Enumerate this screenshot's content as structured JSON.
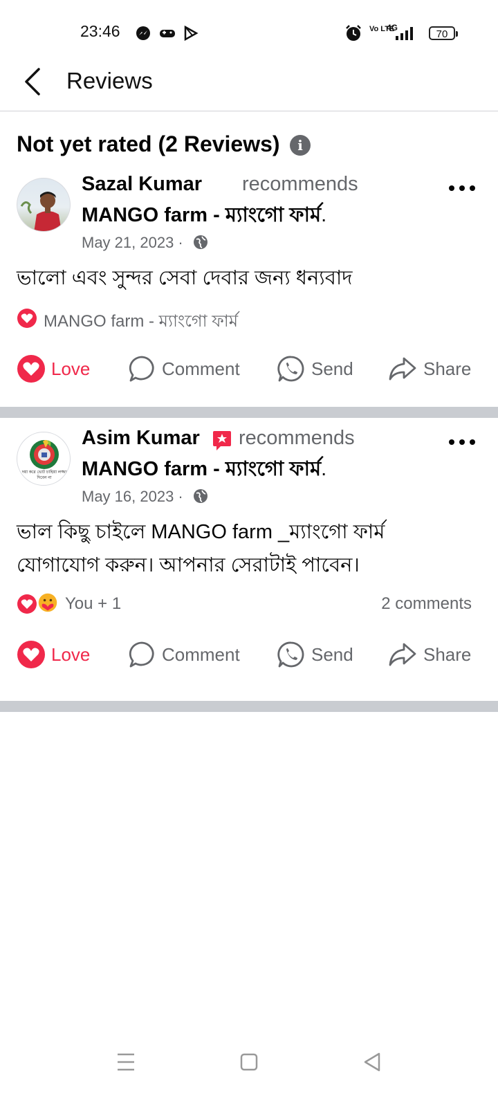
{
  "status_bar": {
    "time": "23:46",
    "network": "4G",
    "volte": "Vo LTE",
    "battery": "70",
    "icons": [
      "messenger-icon",
      "game-icon",
      "play-icon",
      "alarm-icon",
      "volte-icon",
      "signal-icon",
      "battery-icon"
    ]
  },
  "header": {
    "title": "Reviews",
    "back_icon": "chevron-left-icon"
  },
  "section": {
    "title": "Not yet rated (2 Reviews)",
    "info_icon": "info-icon",
    "info_glyph": "i"
  },
  "reviews": [
    {
      "author": "Sazal Kumar",
      "verb": "recommends",
      "page": "MANGO farm - ম্যাংগো ফার্ম",
      "page_suffix": ".",
      "date": "May 21, 2023 ·",
      "text": "ভালো এবং সুন্দর সেবা দেবার জন্য ধন্যবাদ",
      "reaction_label": "MANGO farm - ম্যাংগো ফার্ম",
      "comments": ""
    },
    {
      "author": "Asim Kumar",
      "verb": "recommends",
      "page": "MANGO farm - ম্যাংগো ফার্ম",
      "page_suffix": ".",
      "date": "May 16, 2023 ·",
      "text": "ভাল কিছু চাইলে MANGO farm _ম্যাংগো ফার্ম যোগাযোগ করুন। আপনার সেরাটাই পাবেন।",
      "reaction_label": "You + 1",
      "comments": "2 comments",
      "avatar_text": "দয়া করে ভোট চাহিয়া লজ্জা দিবেন না"
    }
  ],
  "actions": {
    "love": "Love",
    "comment": "Comment",
    "send": "Send",
    "share": "Share"
  },
  "colors": {
    "love": "#f0284a",
    "secondary_text": "#65676b",
    "separator": "#c9ccd1"
  },
  "nav": {
    "icons": [
      "menu-icon",
      "home-square-icon",
      "back-triangle-icon"
    ]
  }
}
